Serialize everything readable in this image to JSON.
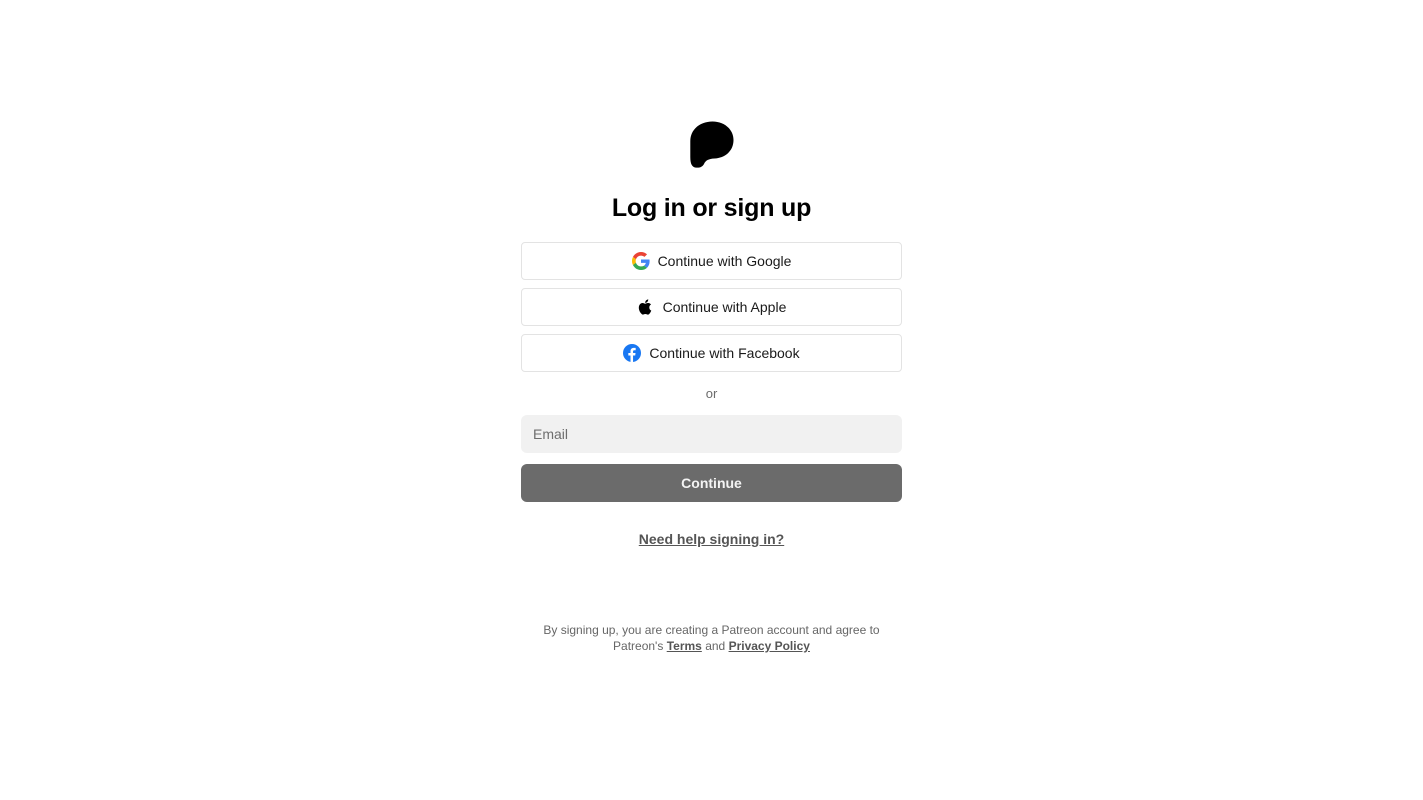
{
  "brand": {
    "name": "Patreon",
    "logo_icon": "patreon-logo-icon"
  },
  "auth": {
    "title": "Log in or sign up",
    "providers": [
      {
        "label": "Continue with Google",
        "icon": "google-icon"
      },
      {
        "label": "Continue with Apple",
        "icon": "apple-icon"
      },
      {
        "label": "Continue with Facebook",
        "icon": "facebook-icon"
      }
    ],
    "divider": "or",
    "email": {
      "placeholder": "Email",
      "value": ""
    },
    "continue_label": "Continue",
    "help_link": "Need help signing in?"
  },
  "legal": {
    "prefix": "By signing up, you are creating a Patreon account and agree to Patreon's",
    "terms": "Terms",
    "conjunction": "and",
    "privacy": "Privacy Policy"
  },
  "colors": {
    "background": "#ffffff",
    "continue_button": "#6b6b6b",
    "input_background": "#f1f1f1",
    "facebook_blue": "#1877f2",
    "google_blue": "#4285f4",
    "google_red": "#ea4335",
    "google_yellow": "#fbbc05",
    "google_green": "#34a853"
  }
}
